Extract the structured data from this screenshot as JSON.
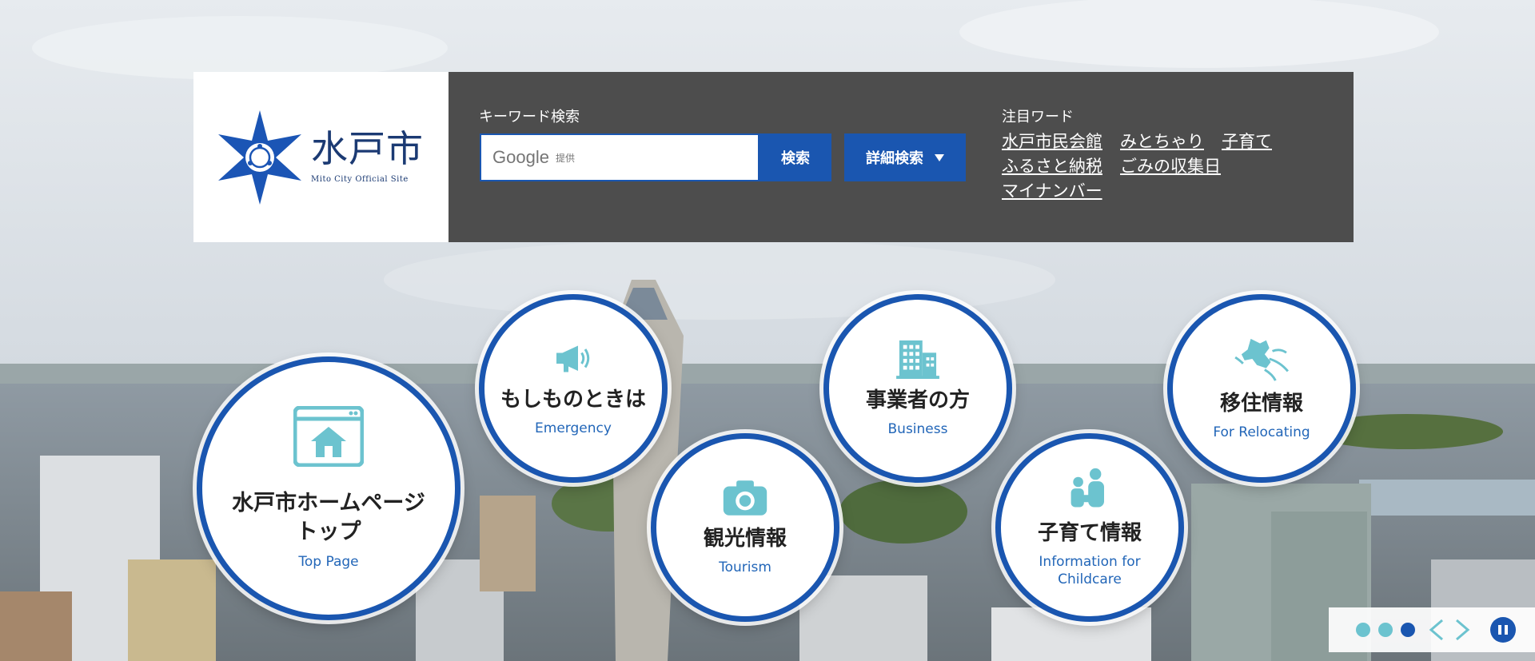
{
  "logo": {
    "name": "水戸市",
    "subtitle": "Mito City Official Site"
  },
  "search": {
    "keyword_label": "キーワード検索",
    "google_word": "Google",
    "google_provided": "提供",
    "search_button": "検索",
    "advanced_button": "詳細検索"
  },
  "trending": {
    "label": "注目ワード",
    "links": [
      "水戸市民会館",
      "みとちゃり",
      "子育て",
      "ふるさと納税",
      "ごみの収集日",
      "マイナンバー"
    ]
  },
  "menu": {
    "top": {
      "jp": "水戸市ホームページトップ",
      "en": "Top Page"
    },
    "emergency": {
      "jp": "もしものときは",
      "en": "Emergency"
    },
    "business": {
      "jp": "事業者の方",
      "en": "Business"
    },
    "relocating": {
      "jp": "移住情報",
      "en": "For Relocating"
    },
    "tourism": {
      "jp": "観光情報",
      "en": "Tourism"
    },
    "childcare": {
      "jp": "子育て情報",
      "en": "Information for Childcare"
    }
  },
  "slider": {
    "dots": 3,
    "active_index": 2
  },
  "colors": {
    "brand_blue": "#1a56b0",
    "icon_teal": "#6cc3cf",
    "panel_gray": "#4d4d4d",
    "logo_navy": "#1b3a73"
  },
  "icons": [
    "star-emblem-icon",
    "homepage-icon",
    "megaphone-icon",
    "building-icon",
    "map-icon",
    "camera-icon",
    "family-icon",
    "chevron-left-icon",
    "chevron-right-icon",
    "pause-icon"
  ]
}
